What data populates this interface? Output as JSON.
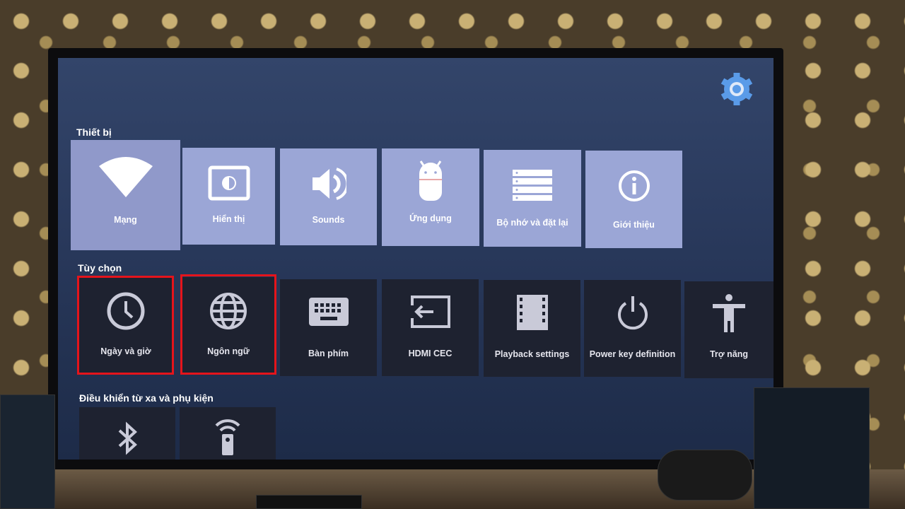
{
  "header": {
    "settings_icon": "gear-icon"
  },
  "sections": [
    {
      "title": "Thiết bị",
      "items": [
        {
          "label": "Mạng",
          "icon": "wifi-icon"
        },
        {
          "label": "Hiển thị",
          "icon": "display-brightness-icon"
        },
        {
          "label": "Sounds",
          "icon": "speaker-icon"
        },
        {
          "label": "Ứng dụng",
          "icon": "android-icon"
        },
        {
          "label": "Bộ nhớ và đặt lại",
          "icon": "storage-icon"
        },
        {
          "label": "Giới thiệu",
          "icon": "info-icon"
        }
      ]
    },
    {
      "title": "Tùy chọn",
      "items": [
        {
          "label": "Ngày và giờ",
          "icon": "clock-icon"
        },
        {
          "label": "Ngôn ngữ",
          "icon": "globe-icon"
        },
        {
          "label": "Bàn phím",
          "icon": "keyboard-icon"
        },
        {
          "label": "HDMI CEC",
          "icon": "input-icon"
        },
        {
          "label": "Playback settings",
          "icon": "film-icon"
        },
        {
          "label": "Power key definition",
          "icon": "power-icon"
        },
        {
          "label": "Trợ năng",
          "icon": "accessibility-icon"
        }
      ]
    },
    {
      "title": "Điều khiển từ xa và phụ kiện",
      "items": [
        {
          "icon": "bluetooth-icon"
        },
        {
          "icon": "remote-icon"
        }
      ]
    }
  ],
  "colors": {
    "focused_tile": "#9ba6d6",
    "dark_tile": "#1e2230",
    "highlight": "#e5141b"
  }
}
